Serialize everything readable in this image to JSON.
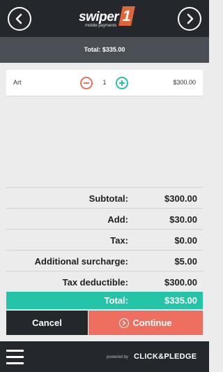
{
  "header": {
    "logo_word": "swiper",
    "logo_number": "1",
    "logo_sub": "mobile payments",
    "back_icon": "arrow-left-icon",
    "forward_icon": "arrow-right-icon"
  },
  "total_bar": {
    "text": "Total: $335.00"
  },
  "item": {
    "name": "Art",
    "quantity": "1",
    "price": "$300.00"
  },
  "summary": [
    {
      "label": "Subtotal:",
      "value": "$300.00"
    },
    {
      "label": "Add:",
      "value": "$30.00"
    },
    {
      "label": "Tax:",
      "value": "$0.00"
    },
    {
      "label": "Additional surcharge:",
      "value": "$5.00"
    },
    {
      "label": "Tax deductible:",
      "value": "$300.00"
    }
  ],
  "total": {
    "label": "Total:",
    "value": "$335.00"
  },
  "actions": {
    "cancel": "Cancel",
    "continue": "Continue"
  },
  "footer": {
    "powered": "powered by",
    "brand": "CLICK&PLEDGE"
  },
  "colors": {
    "dark": "#24272c",
    "accent_teal": "#25c4a9",
    "accent_coral": "#ee6f5f"
  }
}
